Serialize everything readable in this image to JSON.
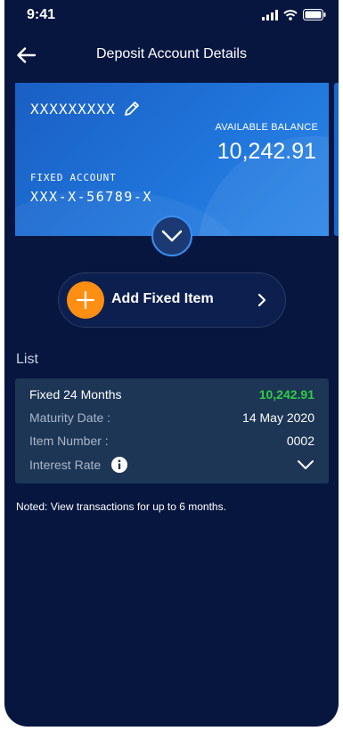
{
  "status_bar": {
    "time": "9:41"
  },
  "header": {
    "title": "Deposit Account Details"
  },
  "account_card": {
    "name": "XXXXXXXXX",
    "available_balance_label": "AVAILABLE BALANCE",
    "balance": "10,242.91",
    "account_type": "FIXED ACCOUNT",
    "account_number": "XXX-X-56789-X"
  },
  "add_button": {
    "label": "Add Fixed Item"
  },
  "list": {
    "title": "List",
    "item": {
      "name": "Fixed 24 Months",
      "amount": "10,242.91",
      "maturity_label": "Maturity Date :",
      "maturity_value": "14 May 2020",
      "item_number_label": "Item Number :",
      "item_number_value": "0002",
      "interest_rate_label": "Interest Rate"
    }
  },
  "note": "Noted: View transactions for up to 6 months.",
  "colors": {
    "background": "#06163f",
    "card_blue": "#1f74da",
    "accent_orange": "#ff8f12",
    "amount_green": "#2ecc40",
    "list_card": "#1d3656"
  },
  "icons": [
    "signal-icon",
    "wifi-icon",
    "battery-icon",
    "back-arrow-icon",
    "pencil-icon",
    "chevron-down-icon",
    "plus-icon",
    "chevron-right-icon",
    "info-icon"
  ]
}
